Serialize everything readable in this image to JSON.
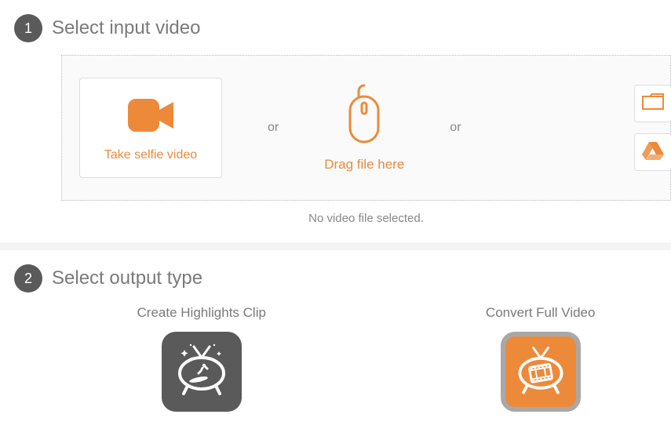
{
  "accent": "#ed8a3a",
  "step1": {
    "number": "1",
    "title": "Select input video",
    "selfie_label": "Take selfie video",
    "or_text": "or",
    "drag_label": "Drag file here",
    "no_file": "No video file selected."
  },
  "step2": {
    "number": "2",
    "title": "Select output type",
    "highlights_label": "Create Highlights Clip",
    "convert_label": "Convert Full Video"
  }
}
